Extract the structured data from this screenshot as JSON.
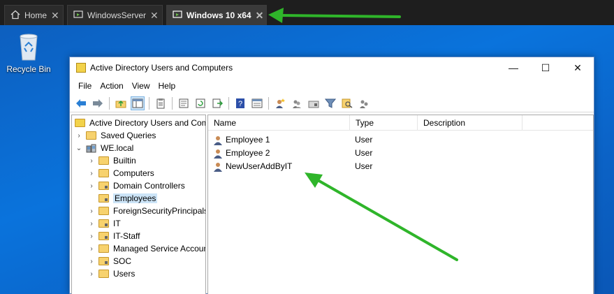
{
  "tabs": [
    {
      "label": "Home",
      "icon": "home-icon",
      "active": false
    },
    {
      "label": "WindowsServer",
      "icon": "vm-icon",
      "active": false
    },
    {
      "label": "Windows 10 x64",
      "icon": "vm-icon",
      "active": true
    }
  ],
  "tab_close_glyph": "✕",
  "desktop": {
    "recycle_bin_label": "Recycle Bin"
  },
  "window": {
    "title": "Active Directory Users and Computers",
    "controls": {
      "minimize": "—",
      "maximize": "☐",
      "close": "✕"
    }
  },
  "menu": [
    "File",
    "Action",
    "View",
    "Help"
  ],
  "toolbar_icons": [
    "back-icon",
    "forward-icon",
    "up-folder-icon",
    "show-hide-tree-icon",
    "clipboard-icon",
    "properties-icon",
    "refresh-icon",
    "export-list-icon",
    "help-icon",
    "console-icon",
    "new-user-icon",
    "new-group-icon",
    "new-ou-icon",
    "filter-icon",
    "find-icon",
    "add-to-group-icon"
  ],
  "tree": {
    "root": "Active Directory Users and Com",
    "saved_queries": "Saved Queries",
    "domain": "WE.local",
    "children": [
      "Builtin",
      "Computers",
      "Domain Controllers",
      "Employees",
      "ForeignSecurityPrincipals",
      "IT",
      "IT-Staff",
      "Managed Service Accoun",
      "SOC",
      "Users"
    ],
    "selected": "Employees"
  },
  "list": {
    "columns": [
      "Name",
      "Type",
      "Description"
    ],
    "rows": [
      {
        "name": "Employee 1",
        "type": "User",
        "description": ""
      },
      {
        "name": "Employee 2",
        "type": "User",
        "description": ""
      },
      {
        "name": "NewUserAddByIT",
        "type": "User",
        "description": ""
      }
    ]
  },
  "colors": {
    "annotation_arrow": "#2fb52a",
    "selection": "#cce4f7",
    "desktop": "#0a6ad0"
  }
}
